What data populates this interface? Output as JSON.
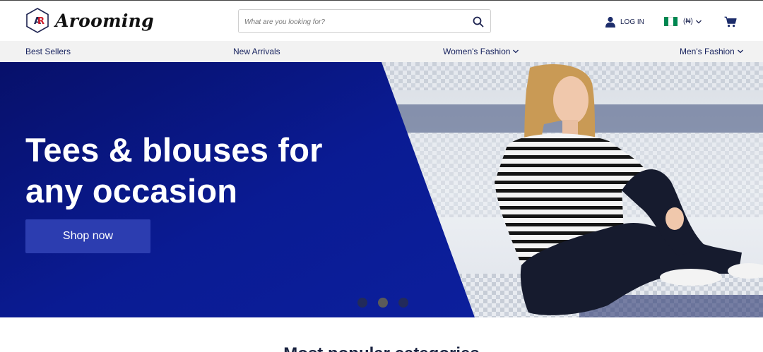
{
  "brand": {
    "name": "Arooming",
    "monogram": "AR"
  },
  "search": {
    "placeholder": "What are you looking for?",
    "icon": "search-icon"
  },
  "account": {
    "login_label": "LOG IN",
    "icon": "user-icon"
  },
  "currency": {
    "label": "(₦)",
    "flag": "nigeria-flag",
    "flag_colors": [
      "#008751",
      "#ffffff",
      "#008751"
    ]
  },
  "cart": {
    "icon": "cart-icon"
  },
  "nav": {
    "items": [
      {
        "label": "Best Sellers",
        "has_dropdown": false
      },
      {
        "label": "New Arrivals",
        "has_dropdown": false
      },
      {
        "label": "Women's Fashion",
        "has_dropdown": true
      },
      {
        "label": "Men's Fashion",
        "has_dropdown": true
      }
    ]
  },
  "hero": {
    "title_line1": "Tees & blouses for",
    "title_line2": "any occasion",
    "cta_label": "Shop now",
    "slides_count": 3,
    "active_slide": 2
  },
  "section": {
    "title": "Most popular categories"
  },
  "colors": {
    "accent": "#2c3db0",
    "hero_blue": "#0a1a8c",
    "nav_bg": "#f2f2f2",
    "text_dark": "#1a2350"
  }
}
